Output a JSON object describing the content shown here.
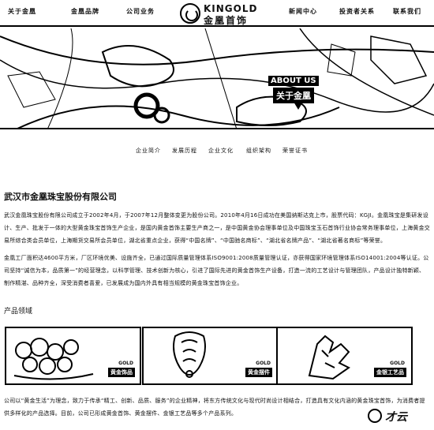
{
  "nav": {
    "left": [
      "关于金凰",
      "金凰品牌",
      "公司业务"
    ],
    "right": [
      "新闻中心",
      "投资者关系",
      "联系我们"
    ]
  },
  "logo": {
    "en": "KINGOLD",
    "cn": "金凰首饰"
  },
  "hero": {
    "about_en": "ABOUT US",
    "about_cn": "关于金凰"
  },
  "subnav": [
    "企业简介",
    "发展历程",
    "企业文化",
    "组织架构",
    "荣誉证书"
  ],
  "company": {
    "title": "武汉市金凰珠宝股份有限公司",
    "para1": "武汉金凰珠宝股份有限公司成立于2002年4月，于2007年12月整体变更为股份公司。2010年4月16日成功在美国纳斯达克上市，股票代码：KGJI。金凰珠宝是集研发设计、生产、批发于一体的大型黄金珠宝首饰生产企业，是国内黄金首饰主要生产商之一，是中国黄金协会理事单位及中国珠宝玉石首饰行业协会常务理事单位，上海黄金交易所综合类会员单位，上海期货交易所会员单位，湖北省重点企业，获得“中国名牌”、“中国驰名商标”、“湖北省名牌产品”、“湖北省著名商标”等荣誉。",
    "para2": "金凰工厂面积达4600平方米，厂区环境优美、设施齐全，已通过国际质量管理体系ISO9001:2008质量管理认证，亦获得国家环境管理体系ISO14001:2004等认证。公司坚持“诚信为本，品质第一”的经营理念，以科学管理、技术创新为核心，引进了国际先进的黄金首饰生产设备，打造一流的工艺设计与管理团队，产品设计独特新颖、制作精湛、品种齐全，深受消费者喜爱，已发展成为国内外具有相当规模的黄金珠宝首饰企业。"
  },
  "products": {
    "title": "产品领域",
    "items": [
      {
        "label": "黄金饰品"
      },
      {
        "label": "黄金摆件"
      },
      {
        "label": "金银工艺品"
      }
    ],
    "brand_mark": "GOLD"
  },
  "bottom": {
    "para": "公司以“黄金生活”为理念，致力于传承“精工、创新、品质、服务”的企业精神，将东方传统文化与现代时尚设计相结合，打造具有文化内涵的黄金珠宝首饰，为消费者提供多样化的产品选择。目前，公司已形成黄金首饰、黄金摆件、金银工艺品等多个产品系列。"
  },
  "watermark": {
    "text": "才云"
  }
}
